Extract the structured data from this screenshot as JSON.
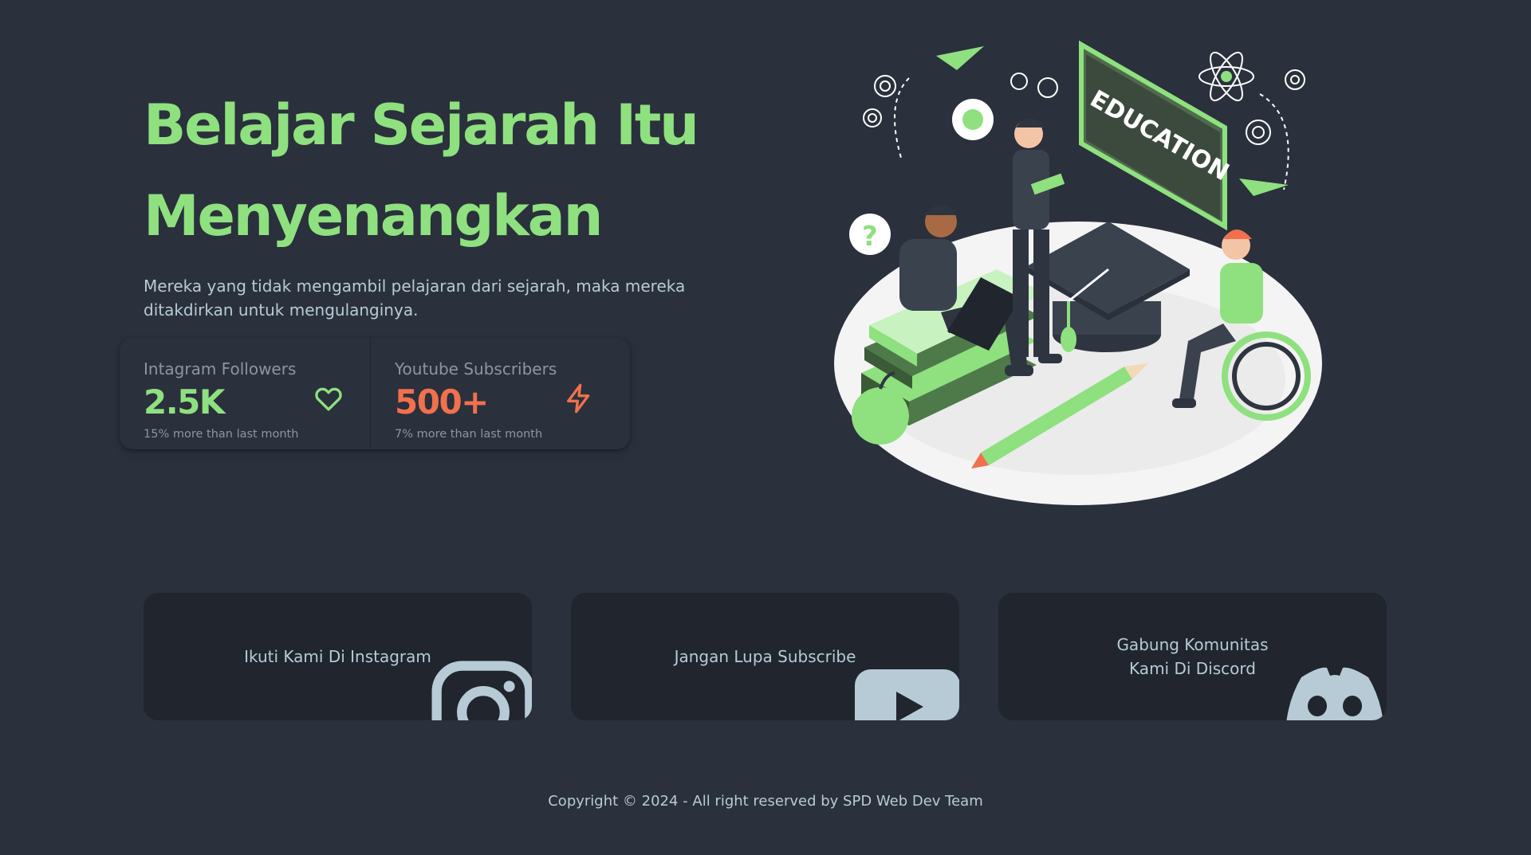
{
  "hero": {
    "title_line1": "Belajar Sejarah Itu",
    "title_line2": "Menyenangkan",
    "subtitle_line1": "Mereka yang tidak mengambil pelajaran dari sejarah, maka mereka",
    "subtitle_line2": "ditakdirkan untuk mengulanginya."
  },
  "stats": [
    {
      "title": "Intagram Followers",
      "value": "2.5K",
      "desc": "15% more than last month",
      "icon": "heart-icon",
      "color": "#8fe07f"
    },
    {
      "title": "Youtube Subscribers",
      "value": "500+",
      "desc": "7% more than last month",
      "icon": "lightning-icon",
      "color": "#f1704d"
    }
  ],
  "illustration": {
    "board_text": "EDUCATION",
    "icon": "education-illustration"
  },
  "cards": [
    {
      "label_line1": "Ikuti Kami Di Instagram",
      "label_line2": "",
      "icon": "instagram-icon"
    },
    {
      "label_line1": "Jangan Lupa Subscribe",
      "label_line2": "",
      "icon": "youtube-icon"
    },
    {
      "label_line1": "Gabung Komunitas",
      "label_line2": "Kami Di Discord",
      "icon": "discord-icon"
    }
  ],
  "footer": {
    "copyright": "Copyright © 2024 - All right reserved by SPD Web Dev Team"
  },
  "colors": {
    "background": "#2a303c",
    "card": "#20252e",
    "accent_green": "#8fe07f",
    "accent_red": "#f1704d",
    "icon_blue": "#b7cbd6"
  }
}
